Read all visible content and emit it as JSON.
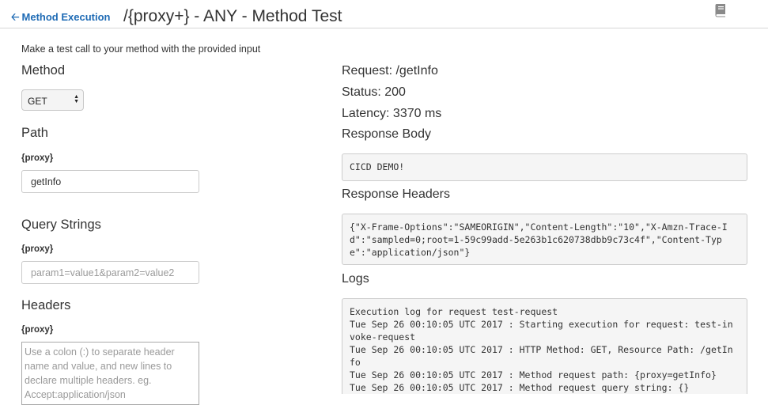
{
  "header": {
    "back_label": "Method Execution",
    "title": "/{proxy+} - ANY - Method Test"
  },
  "form": {
    "intro": "Make a test call to your method with the provided input",
    "method_title": "Method",
    "method_value": "GET",
    "path_title": "Path",
    "path_param_label": "{proxy}",
    "path_value": "getInfo",
    "query_title": "Query Strings",
    "query_param_label": "{proxy}",
    "query_placeholder": "param1=value1&param2=value2",
    "headers_title": "Headers",
    "headers_param_label": "{proxy}",
    "headers_placeholder": "Use a colon (:) to separate header name and value, and new lines to declare multiple headers. eg. Accept:application/json"
  },
  "result": {
    "request": "Request: /getInfo",
    "status": "Status: 200",
    "latency": "Latency: 3370 ms",
    "body_title": "Response Body",
    "body": "CICD DEMO!",
    "headers_title": "Response Headers",
    "headers_json": "{\"X-Frame-Options\":\"SAMEORIGIN\",\"Content-Length\":\"10\",\"X-Amzn-Trace-I\nd\":\"sampled=0;root=1-59c99add-5e263b1c620738dbb9c73c4f\",\"Content-Typ\ne\":\"application/json\"}",
    "logs_title": "Logs",
    "logs": "Execution log for request test-request\nTue Sep 26 00:10:05 UTC 2017 : Starting execution for request: test-in\nvoke-request\nTue Sep 26 00:10:05 UTC 2017 : HTTP Method: GET, Resource Path: /getIn\nfo\nTue Sep 26 00:10:05 UTC 2017 : Method request path: {proxy=getInfo}\nTue Sep 26 00:10:05 UTC 2017 : Method request query string: {}"
  },
  "icons": {
    "back": "arrow-left-icon",
    "docs": "book-icon",
    "select": "select-caret-icon"
  },
  "colors": {
    "link": "#1f6bb5",
    "code_bg": "#f5f5f5"
  }
}
